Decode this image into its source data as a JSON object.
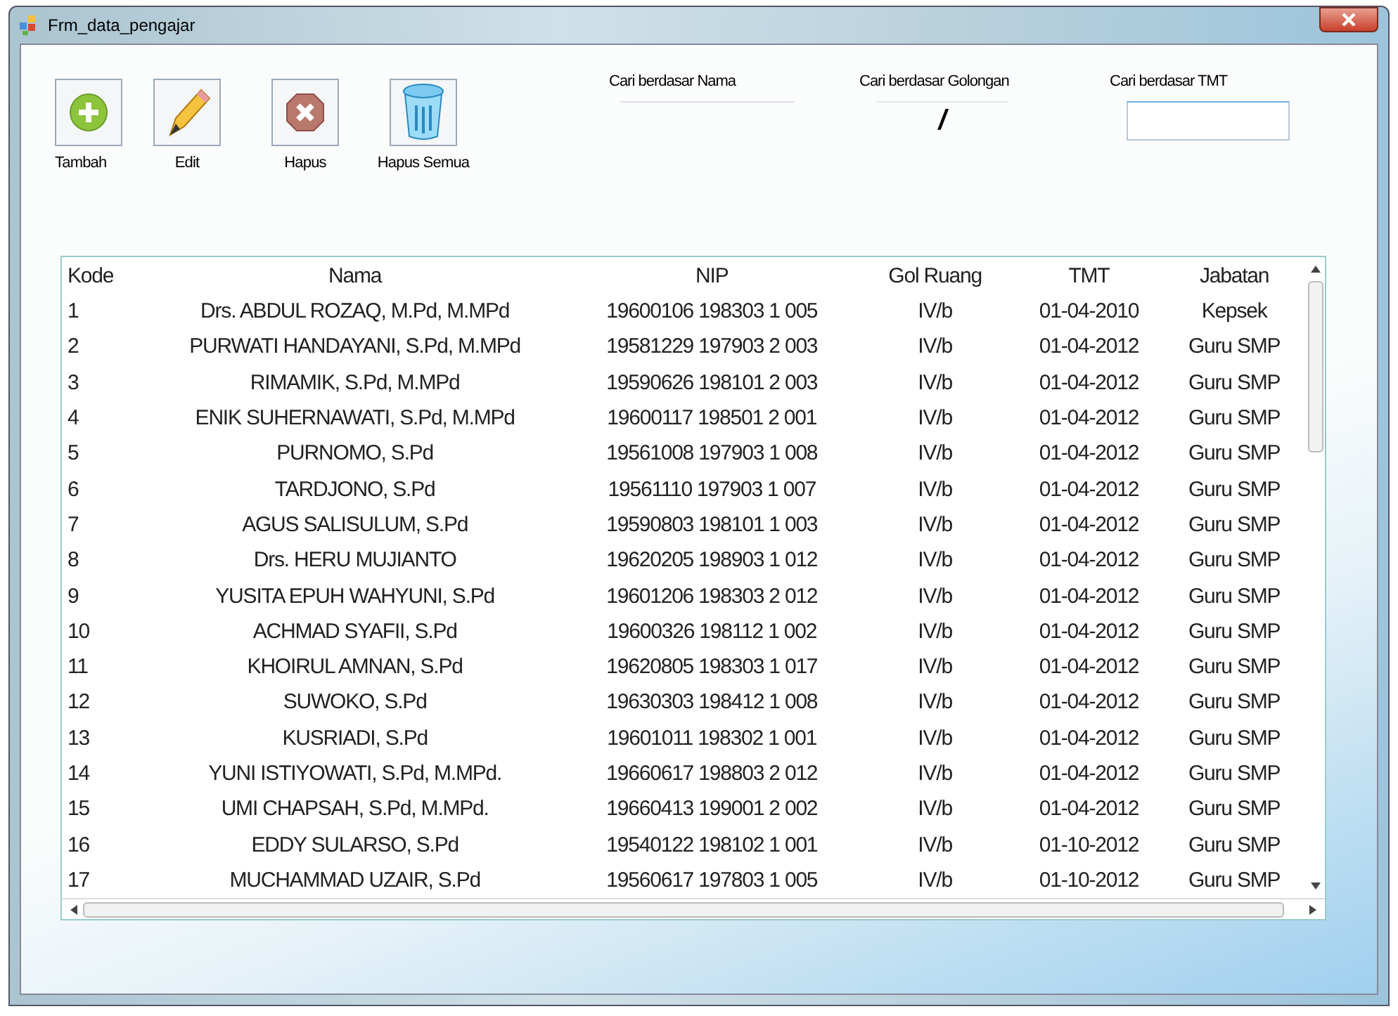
{
  "window": {
    "title": "Frm_data_pengajar"
  },
  "toolbar": [
    {
      "kind": "add",
      "label": "Tambah"
    },
    {
      "kind": "edit",
      "label": "Edit"
    },
    {
      "kind": "delete",
      "label": "Hapus"
    },
    {
      "kind": "trash",
      "label": "Hapus Semua"
    }
  ],
  "search": [
    {
      "kind": "line",
      "label": "Cari berdasar Nama"
    },
    {
      "kind": "masked",
      "label": "Cari berdasar Golongan",
      "value": "/"
    },
    {
      "kind": "box",
      "label": "Cari berdasar TMT"
    }
  ],
  "table": {
    "columns": [
      "Kode",
      "Nama",
      "NIP",
      "Gol Ruang",
      "TMT",
      "Jabatan"
    ],
    "rows": [
      [
        "1",
        "Drs. ABDUL ROZAQ, M.Pd, M.MPd",
        "19600106 198303 1 005",
        "IV/b",
        "01-04-2010",
        "Kepsek"
      ],
      [
        "2",
        "PURWATI HANDAYANI, S.Pd, M.MPd",
        "19581229 197903 2 003",
        "IV/b",
        "01-04-2012",
        "Guru SMP"
      ],
      [
        "3",
        "RIMAMIK, S.Pd, M.MPd",
        "19590626 198101 2 003",
        "IV/b",
        "01-04-2012",
        "Guru SMP"
      ],
      [
        "4",
        "ENIK SUHERNAWATI, S.Pd, M.MPd",
        "19600117 198501 2 001",
        "IV/b",
        "01-04-2012",
        "Guru SMP"
      ],
      [
        "5",
        "PURNOMO, S.Pd",
        "19561008 197903 1 008",
        "IV/b",
        "01-04-2012",
        "Guru SMP"
      ],
      [
        "6",
        "TARDJONO, S.Pd",
        "19561110 197903 1 007",
        "IV/b",
        "01-04-2012",
        "Guru SMP"
      ],
      [
        "7",
        "AGUS SALISULUM, S.Pd",
        "19590803 198101 1 003",
        "IV/b",
        "01-04-2012",
        "Guru SMP"
      ],
      [
        "8",
        "Drs. HERU MUJIANTO",
        "19620205 198903 1 012",
        "IV/b",
        "01-04-2012",
        "Guru SMP"
      ],
      [
        "9",
        "YUSITA EPUH WAHYUNI, S.Pd",
        "19601206 198303 2 012",
        "IV/b",
        "01-04-2012",
        "Guru SMP"
      ],
      [
        "10",
        "ACHMAD SYAFII, S.Pd",
        "19600326 198112 1 002",
        "IV/b",
        "01-04-2012",
        "Guru SMP"
      ],
      [
        "11",
        "KHOIRUL AMNAN, S.Pd",
        "19620805 198303 1 017",
        "IV/b",
        "01-04-2012",
        "Guru SMP"
      ],
      [
        "12",
        "SUWOKO, S.Pd",
        "19630303 198412 1 008",
        "IV/b",
        "01-04-2012",
        "Guru SMP"
      ],
      [
        "13",
        "KUSRIADI, S.Pd",
        "19601011 198302 1 001",
        "IV/b",
        "01-04-2012",
        "Guru SMP"
      ],
      [
        "14",
        "YUNI ISTIYOWATI, S.Pd, M.MPd.",
        "19660617 198803 2 012",
        "IV/b",
        "01-04-2012",
        "Guru SMP"
      ],
      [
        "15",
        "UMI CHAPSAH, S.Pd, M.MPd.",
        "19660413 199001 2 002",
        "IV/b",
        "01-04-2012",
        "Guru SMP"
      ],
      [
        "16",
        "EDDY SULARSO, S.Pd",
        "19540122 198102 1 001",
        "IV/b",
        "01-10-2012",
        "Guru SMP"
      ],
      [
        "17",
        "MUCHAMMAD UZAIR, S.Pd",
        "19560617 197803 1 005",
        "IV/b",
        "01-10-2012",
        "Guru SMP"
      ]
    ]
  }
}
